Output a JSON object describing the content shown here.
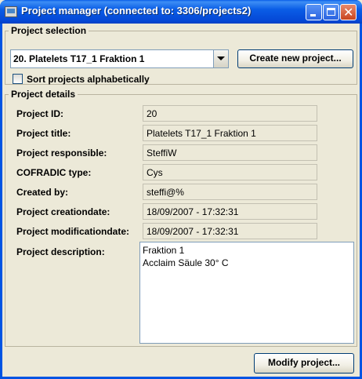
{
  "window": {
    "title": "Project manager (connected to: 3306/projects2)"
  },
  "project_selection": {
    "group_title": "Project selection",
    "selected_project": "20. Platelets T17_1 Fraktion 1",
    "create_button_label": "Create new project...",
    "sort_checkbox_label": "Sort projects alphabetically",
    "sort_checked": false
  },
  "project_details": {
    "group_title": "Project details",
    "fields": [
      {
        "label": "Project ID:",
        "value": "20"
      },
      {
        "label": "Project title:",
        "value": "Platelets T17_1 Fraktion 1"
      },
      {
        "label": "Project responsible:",
        "value": "SteffiW"
      },
      {
        "label": "COFRADIC type:",
        "value": "Cys"
      },
      {
        "label": "Created by:",
        "value": "steffi@%"
      },
      {
        "label": "Project creationdate:",
        "value": "18/09/2007 - 17:32:31"
      },
      {
        "label": "Project modificationdate:",
        "value": "18/09/2007 - 17:32:31"
      }
    ],
    "description_label": "Project description:",
    "description_lines": [
      "Fraktion 1",
      "Acclaim Säule 30° C"
    ]
  },
  "footer": {
    "modify_button_label": "Modify project..."
  }
}
